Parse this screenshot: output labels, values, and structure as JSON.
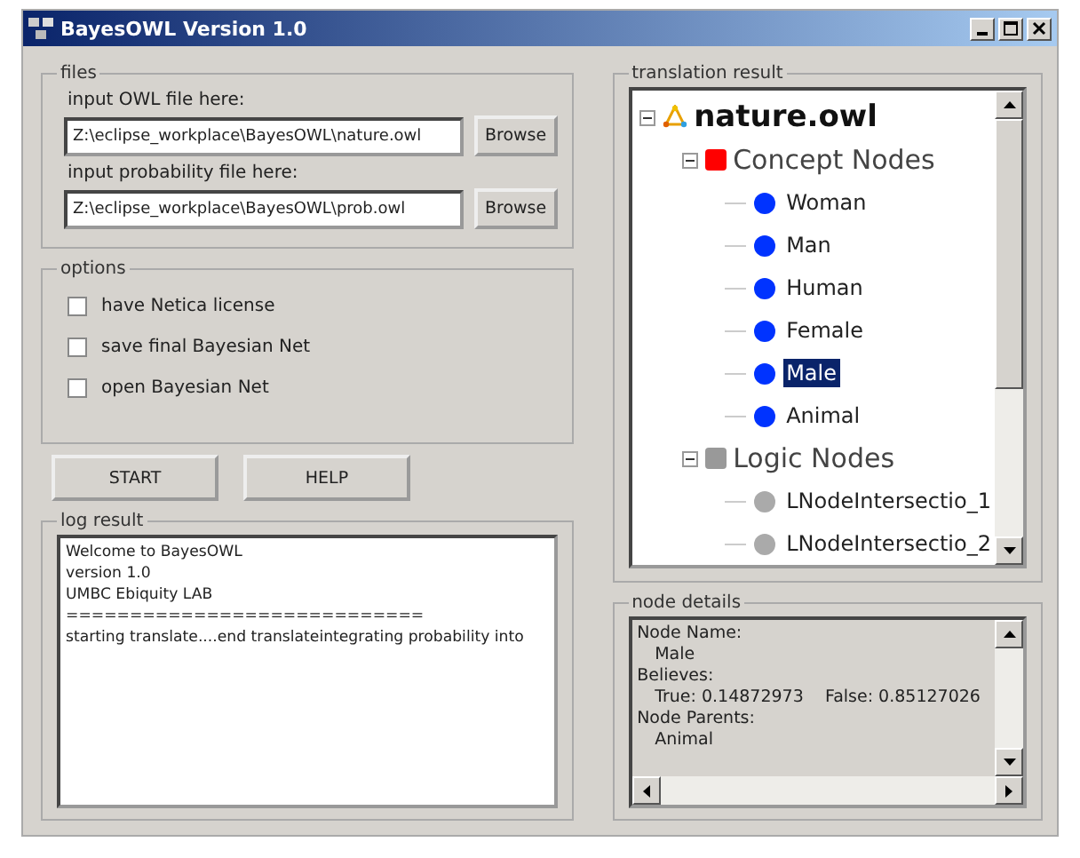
{
  "window": {
    "title": "BayesOWL Version 1.0"
  },
  "files": {
    "title": "files",
    "inputs": [
      {
        "label": "input OWL file here:",
        "value": "Z:\\eclipse_workplace\\BayesOWL\\nature.owl",
        "button": "Browse"
      },
      {
        "label": "input probability file here:",
        "value": "Z:\\eclipse_workplace\\BayesOWL\\prob.owl",
        "button": "Browse"
      }
    ]
  },
  "options": {
    "title": "options",
    "items": [
      {
        "label": "have Netica license",
        "checked": false
      },
      {
        "label": "save final Bayesian Net",
        "checked": false
      },
      {
        "label": "open Bayesian Net",
        "checked": false
      }
    ]
  },
  "buttons": [
    "START",
    "HELP"
  ],
  "log": {
    "title": "log result",
    "lines": [
      "Welcome to BayesOWL",
      "version 1.0",
      "UMBC Ebiquity LAB",
      "============================",
      "starting translate....end translateintegrating probability into"
    ]
  },
  "translation": {
    "title": "translation result",
    "tree": [
      {
        "label": "nature.owl",
        "kind": "root",
        "expanded": true,
        "children": [
          {
            "label": "Concept Nodes",
            "kind": "group",
            "color": "#ff0000",
            "expanded": true,
            "children": [
              {
                "label": "Woman",
                "kind": "leaf",
                "color": "#0033ff",
                "selected": false
              },
              {
                "label": "Man",
                "kind": "leaf",
                "color": "#0033ff",
                "selected": false
              },
              {
                "label": "Human",
                "kind": "leaf",
                "color": "#0033ff",
                "selected": false
              },
              {
                "label": "Female",
                "kind": "leaf",
                "color": "#0033ff",
                "selected": false
              },
              {
                "label": "Male",
                "kind": "leaf",
                "color": "#0033ff",
                "selected": true
              },
              {
                "label": "Animal",
                "kind": "leaf",
                "color": "#0033ff",
                "selected": false
              }
            ]
          },
          {
            "label": "Logic Nodes",
            "kind": "group",
            "color": "#999999",
            "expanded": true,
            "children": [
              {
                "label": "LNodeIntersectio_1",
                "kind": "leaf",
                "color": "#aaaaaa",
                "selected": false
              },
              {
                "label": "LNodeIntersectio_2",
                "kind": "leaf",
                "color": "#aaaaaa",
                "selected": false
              }
            ]
          }
        ]
      }
    ]
  },
  "node_details": {
    "title": "node details",
    "lines": [
      {
        "kind": "heading",
        "text": "Node Name:"
      },
      {
        "kind": "value",
        "text": "Male"
      },
      {
        "kind": "heading",
        "text": "Believes:"
      },
      {
        "kind": "value",
        "text": "True: 0.14872973    False: 0.85127026"
      },
      {
        "kind": "heading",
        "text": "Node Parents:"
      },
      {
        "kind": "value",
        "text": "Animal"
      }
    ]
  }
}
